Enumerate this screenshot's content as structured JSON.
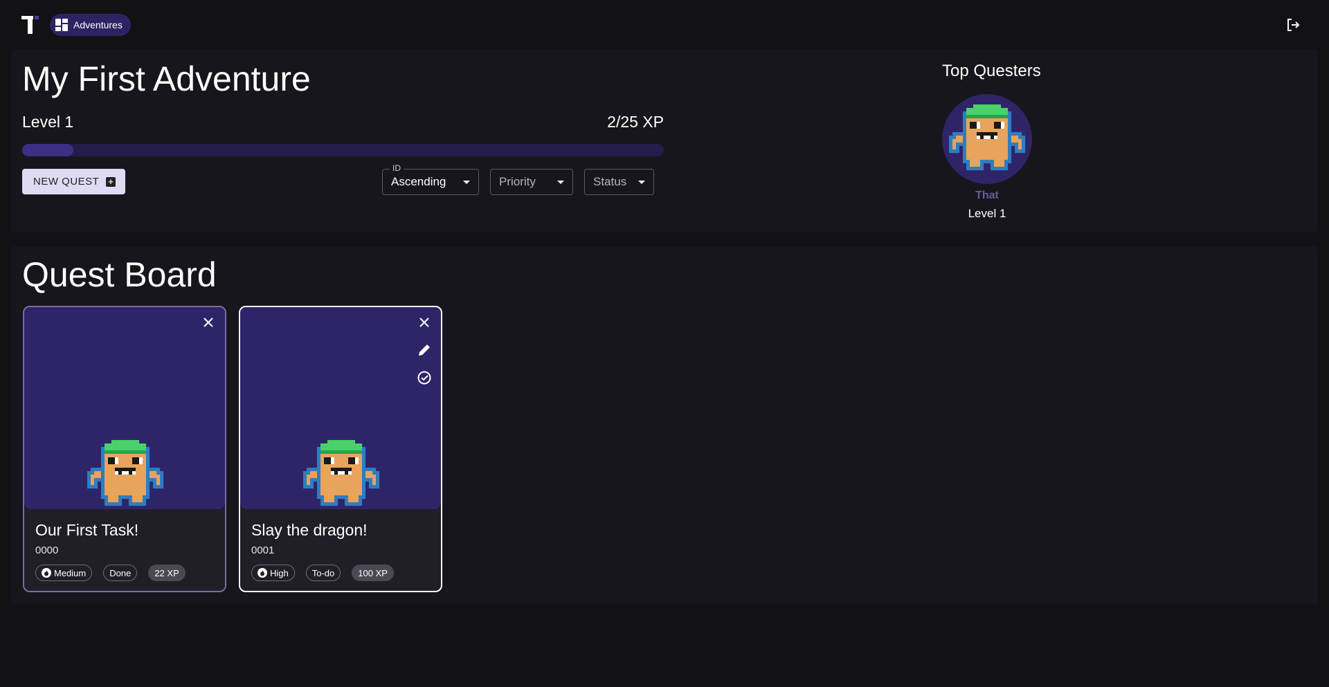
{
  "nav": {
    "chip_label": "Adventures"
  },
  "adventure": {
    "title": "My First Adventure",
    "level_label": "Level 1",
    "xp_label": "2/25 XP",
    "xp_progress": 0.08,
    "new_quest_label": "NEW QUEST",
    "sort": {
      "id_label": "ID",
      "id_value": "Ascending",
      "priority_placeholder": "Priority",
      "status_placeholder": "Status"
    }
  },
  "top_questers": {
    "heading": "Top Questers",
    "entries": [
      {
        "name": "That",
        "level": "Level 1"
      }
    ]
  },
  "board": {
    "title": "Quest Board",
    "cards": [
      {
        "title": "Our First Task!",
        "id": "0000",
        "priority": "Medium",
        "status": "Done",
        "xp": "22 XP"
      },
      {
        "title": "Slay the dragon!",
        "id": "0001",
        "priority": "High",
        "status": "To-do",
        "xp": "100 XP"
      }
    ]
  },
  "colors": {
    "background": "#111116",
    "panel": "#17161c",
    "accent": "#2c2363",
    "progress_fill": "#3b2f86",
    "card_media": "#2e2569"
  }
}
